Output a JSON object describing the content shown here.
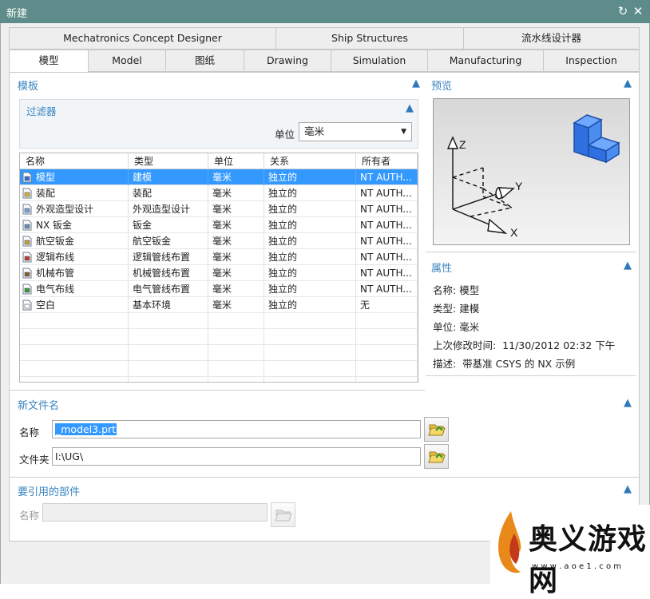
{
  "window": {
    "title": "新建",
    "refresh_icon": "↻",
    "close_icon": "✕"
  },
  "tabs_row1": [
    "Mechatronics Concept Designer",
    "Ship Structures",
    "流水线设计器"
  ],
  "tabs_row2": [
    "模型",
    "Model",
    "图纸",
    "Drawing",
    "Simulation",
    "Manufacturing",
    "Inspection"
  ],
  "templates": {
    "title": "模板",
    "filter": {
      "title": "过滤器",
      "unit_label": "单位",
      "unit_value": "毫米"
    },
    "columns": [
      "名称",
      "类型",
      "单位",
      "关系",
      "所有者"
    ],
    "rows": [
      {
        "name": "模型",
        "type": "建模",
        "unit": "毫米",
        "relation": "独立的",
        "owner": "NT AUTH...",
        "icon": "model-icon",
        "selected": true
      },
      {
        "name": "装配",
        "type": "装配",
        "unit": "毫米",
        "relation": "独立的",
        "owner": "NT AUTH...",
        "icon": "assembly-icon",
        "selected": false
      },
      {
        "name": "外观造型设计",
        "type": "外观造型设计",
        "unit": "毫米",
        "relation": "独立的",
        "owner": "NT AUTH...",
        "icon": "shape-design-icon",
        "selected": false
      },
      {
        "name": "NX 钣金",
        "type": "钣金",
        "unit": "毫米",
        "relation": "独立的",
        "owner": "NT AUTH...",
        "icon": "sheet-metal-icon",
        "selected": false
      },
      {
        "name": "航空钣金",
        "type": "航空钣金",
        "unit": "毫米",
        "relation": "独立的",
        "owner": "NT AUTH...",
        "icon": "aero-sheet-metal-icon",
        "selected": false
      },
      {
        "name": "逻辑布线",
        "type": "逻辑管线布置",
        "unit": "毫米",
        "relation": "独立的",
        "owner": "NT AUTH...",
        "icon": "logical-routing-icon",
        "selected": false
      },
      {
        "name": "机械布管",
        "type": "机械管线布置",
        "unit": "毫米",
        "relation": "独立的",
        "owner": "NT AUTH...",
        "icon": "mechanical-routing-icon",
        "selected": false
      },
      {
        "name": "电气布线",
        "type": "电气管线布置",
        "unit": "毫米",
        "relation": "独立的",
        "owner": "NT AUTH...",
        "icon": "electrical-routing-icon",
        "selected": false
      },
      {
        "name": "空白",
        "type": "基本环境",
        "unit": "毫米",
        "relation": "独立的",
        "owner": "无",
        "icon": "blank-icon",
        "selected": false
      }
    ]
  },
  "preview": {
    "title": "预览",
    "axes": [
      "Z",
      "Y",
      "X"
    ]
  },
  "properties": {
    "title": "属性",
    "items": [
      {
        "label": "名称:",
        "value": "模型"
      },
      {
        "label": "类型:",
        "value": "建模"
      },
      {
        "label": "单位:",
        "value": "毫米"
      },
      {
        "label": "上次修改时间:",
        "value": "11/30/2012 02:32 下午"
      },
      {
        "label": "描述:",
        "value": "带基准 CSYS 的 NX 示例"
      }
    ]
  },
  "new_file": {
    "title": "新文件名",
    "name_label": "名称",
    "name_value": "_model3.prt",
    "folder_label": "文件夹",
    "folder_value": "I:\\UG\\"
  },
  "ref_parts": {
    "title": "要引用的部件",
    "name_label": "名称",
    "name_value": ""
  },
  "watermark": {
    "text": "奥义游戏网",
    "url": "w w w . a o e 1 . c o m"
  },
  "colors": {
    "accent": "#3a84c0",
    "selection": "#3399ff",
    "titlebar": "#5d8c8a"
  }
}
